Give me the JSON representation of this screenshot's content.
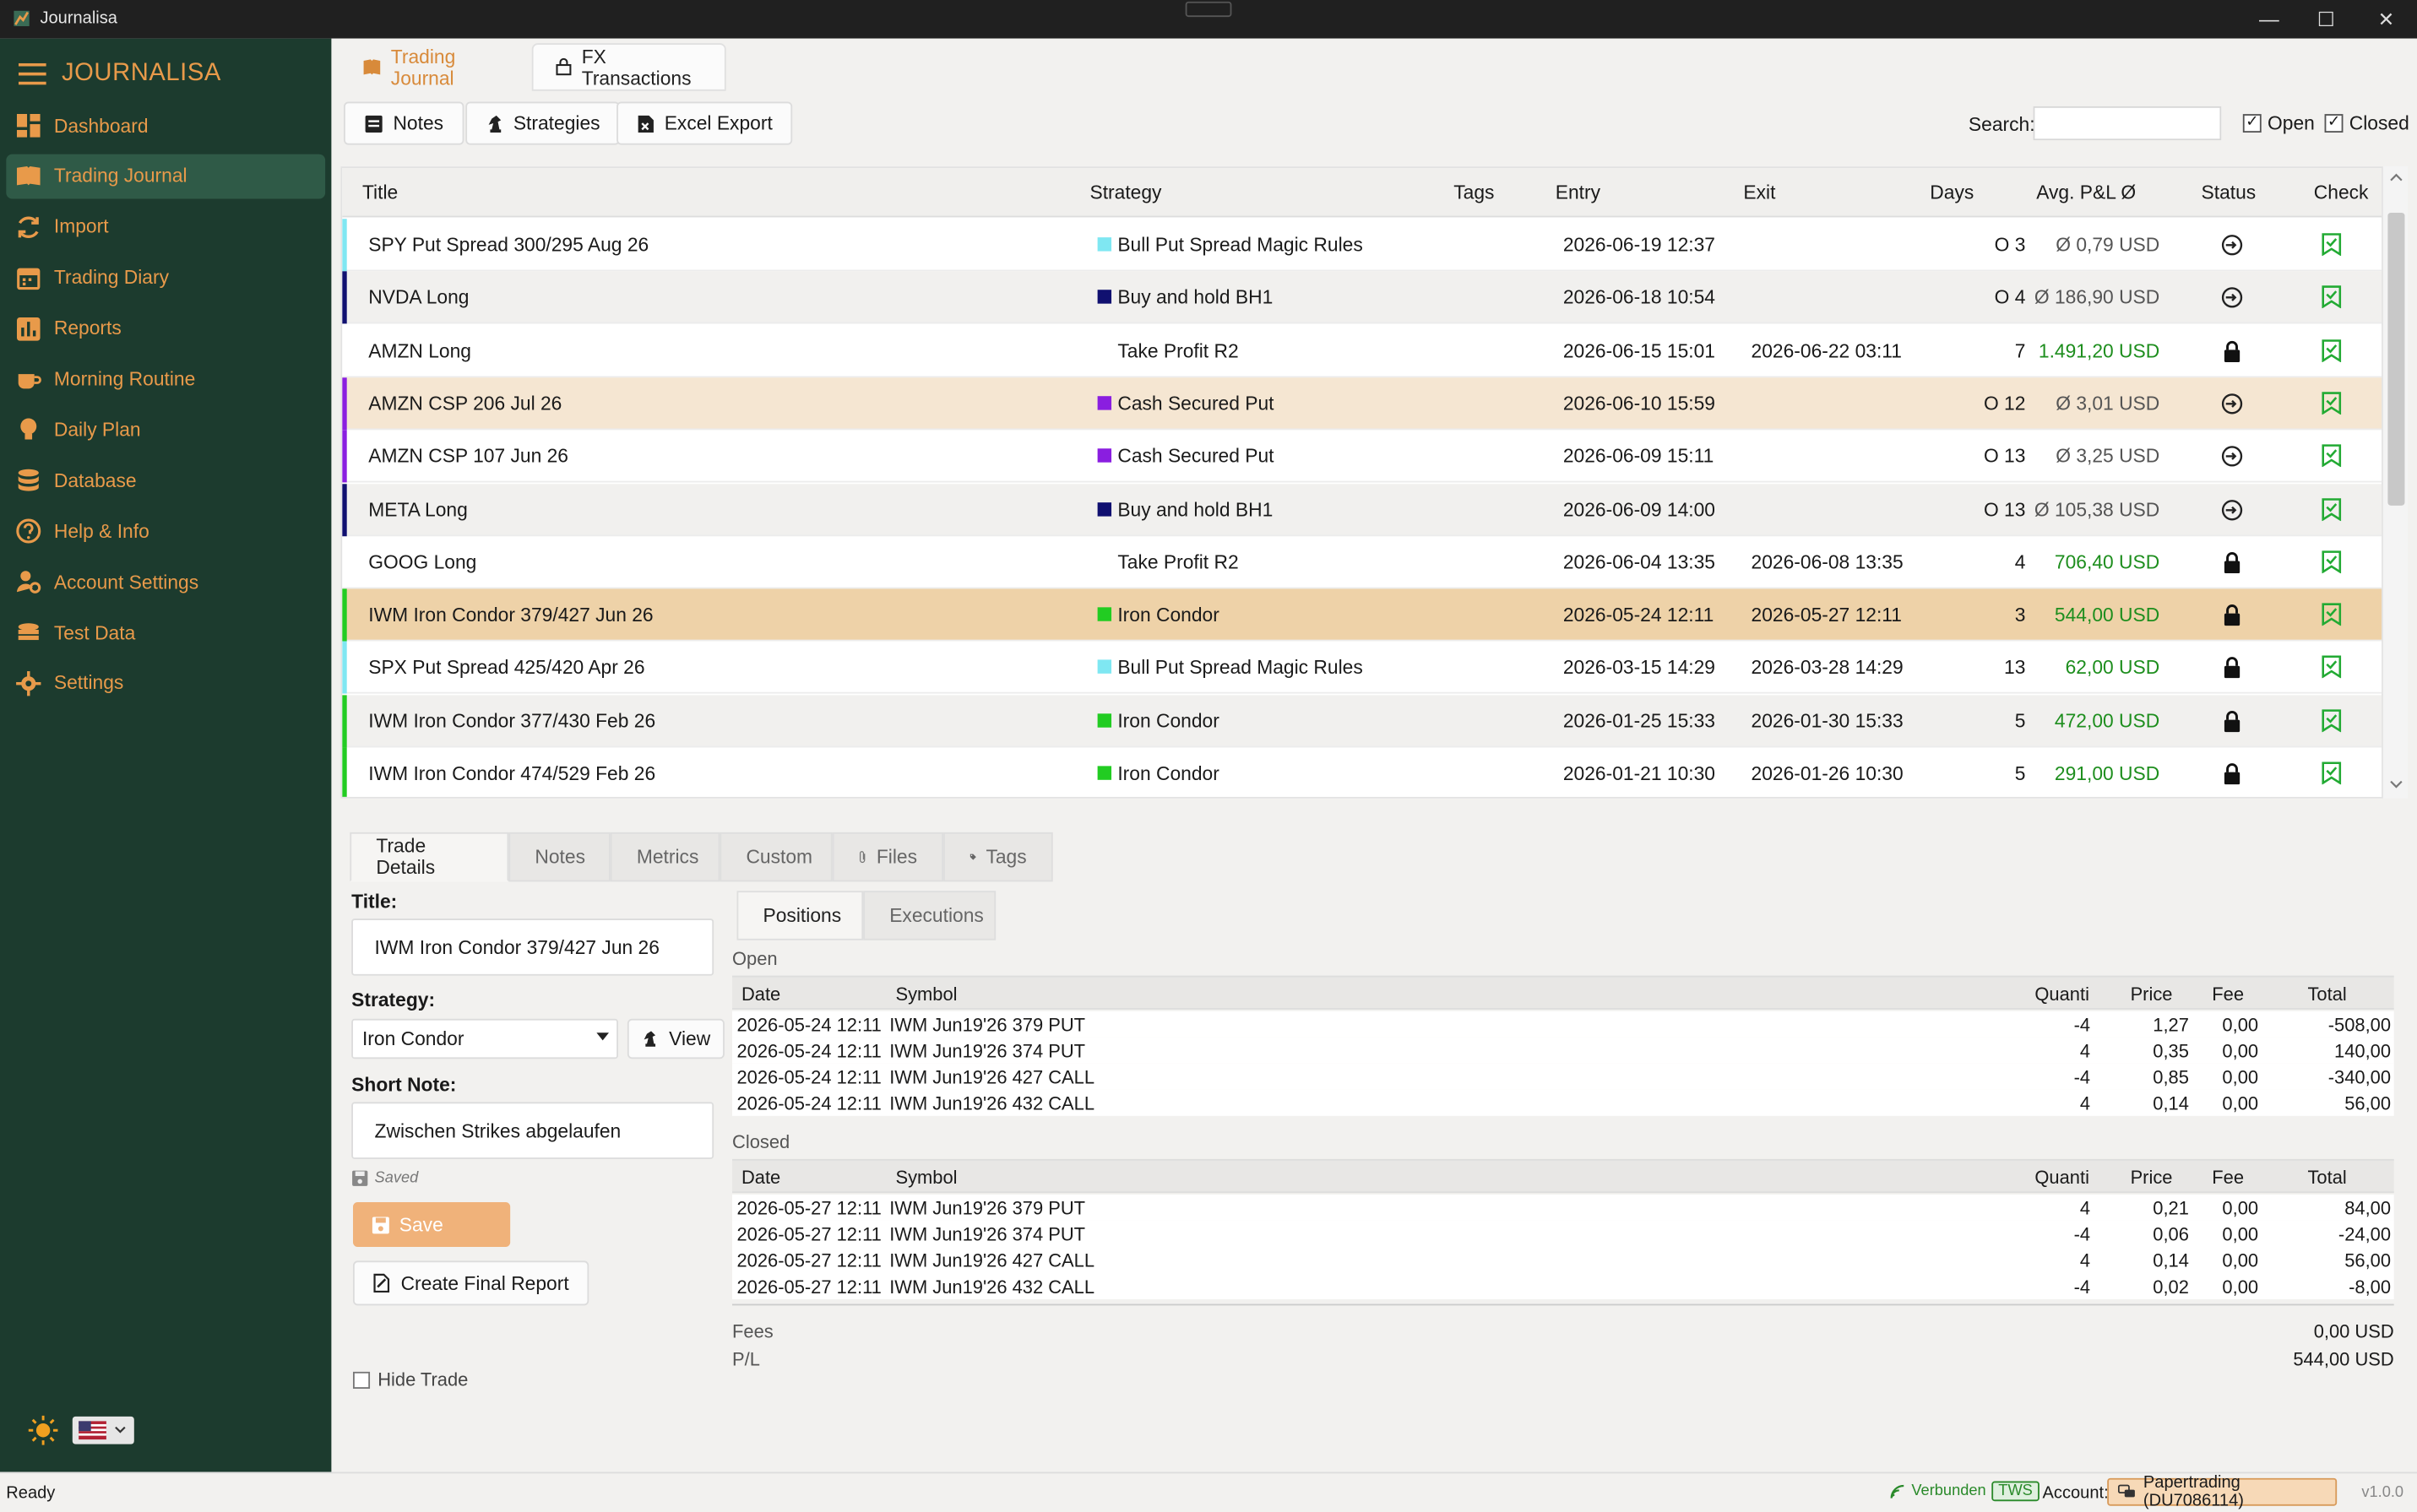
{
  "window": {
    "title": "Journalisa",
    "minimize": "—",
    "maximize": "☐",
    "close": "✕"
  },
  "sidebar": {
    "logo": "JOURNALISA",
    "items": [
      {
        "label": "Dashboard",
        "icon": "dashboard-icon"
      },
      {
        "label": "Trading Journal",
        "icon": "book-icon"
      },
      {
        "label": "Import",
        "icon": "sync-icon"
      },
      {
        "label": "Trading Diary",
        "icon": "calendar-icon"
      },
      {
        "label": "Reports",
        "icon": "bar-chart-icon"
      },
      {
        "label": "Morning Routine",
        "icon": "coffee-icon"
      },
      {
        "label": "Daily Plan",
        "icon": "lightbulb-icon"
      },
      {
        "label": "Database",
        "icon": "database-icon"
      },
      {
        "label": "Help & Info",
        "icon": "help-icon"
      },
      {
        "label": "Account Settings",
        "icon": "user-gear-icon"
      },
      {
        "label": "Test Data",
        "icon": "coins-icon"
      },
      {
        "label": "Settings",
        "icon": "gear-icon"
      }
    ],
    "active_index": 1
  },
  "top_tabs": [
    "Trading Journal",
    "FX Transactions"
  ],
  "toolbar": {
    "notes": "Notes",
    "strategies": "Strategies",
    "excel": "Excel Export",
    "search_label": "Search:",
    "search_value": "",
    "open_label": "Open",
    "closed_label": "Closed"
  },
  "grid": {
    "columns": [
      "Title",
      "Strategy",
      "Tags",
      "Entry",
      "Exit",
      "Days",
      "Avg. P&L Ø",
      "Status",
      "Check"
    ],
    "rows": [
      {
        "title": "SPY Put Spread 300/295 Aug 26",
        "strategy": "Bull Put Spread Magic Rules",
        "color": "#7fe7f2",
        "entry": "2026-06-19 12:37",
        "exit": "",
        "days": "O 3",
        "pl": "Ø 0,79 USD",
        "status": "open",
        "bg": "#ffffff",
        "plc": "pl-grey"
      },
      {
        "title": "NVDA Long",
        "strategy": "Buy and hold BH1",
        "color": "#101070",
        "entry": "2026-06-18 10:54",
        "exit": "",
        "days": "O 4",
        "pl": "Ø 186,90 USD",
        "status": "open",
        "bg": "#f1f0ee",
        "plc": "pl-grey"
      },
      {
        "title": "AMZN Long",
        "strategy": "Take Profit R2",
        "color": "",
        "entry": "2026-06-15 15:01",
        "exit": "2026-06-22 03:11",
        "days": "7",
        "pl": "1.491,20 USD",
        "status": "closed",
        "bg": "#ffffff",
        "plc": "pl-green"
      },
      {
        "title": "AMZN CSP 206 Jul 26",
        "strategy": "Cash Secured Put",
        "color": "#8a1ee0",
        "entry": "2026-06-10 15:59",
        "exit": "",
        "days": "O 12",
        "pl": "Ø 3,01 USD",
        "status": "open",
        "bg": "#f5e6d2",
        "plc": "pl-grey"
      },
      {
        "title": "AMZN CSP 107 Jun 26",
        "strategy": "Cash Secured Put",
        "color": "#8a1ee0",
        "entry": "2026-06-09 15:11",
        "exit": "",
        "days": "O 13",
        "pl": "Ø 3,25 USD",
        "status": "open",
        "bg": "#ffffff",
        "plc": "pl-grey"
      },
      {
        "title": "META Long",
        "strategy": "Buy and hold BH1",
        "color": "#101070",
        "entry": "2026-06-09 14:00",
        "exit": "",
        "days": "O 13",
        "pl": "Ø 105,38 USD",
        "status": "open",
        "bg": "#f1f0ee",
        "plc": "pl-grey"
      },
      {
        "title": "GOOG Long",
        "strategy": "Take Profit R2",
        "color": "",
        "entry": "2026-06-04 13:35",
        "exit": "2026-06-08 13:35",
        "days": "4",
        "pl": "706,40 USD",
        "status": "closed",
        "bg": "#ffffff",
        "plc": "pl-green"
      },
      {
        "title": "IWM Iron Condor 379/427 Jun 26",
        "strategy": "Iron Condor",
        "color": "#22cc22",
        "entry": "2026-05-24 12:11",
        "exit": "2026-05-27 12:11",
        "days": "3",
        "pl": "544,00 USD",
        "status": "closed",
        "bg": "#eed2a8",
        "plc": "pl-green"
      },
      {
        "title": "SPX Put Spread 425/420 Apr 26",
        "strategy": "Bull Put Spread Magic Rules",
        "color": "#7fe7f2",
        "entry": "2026-03-15 14:29",
        "exit": "2026-03-28 14:29",
        "days": "13",
        "pl": "62,00 USD",
        "status": "closed",
        "bg": "#ffffff",
        "plc": "pl-green"
      },
      {
        "title": "IWM Iron Condor 377/430 Feb 26",
        "strategy": "Iron Condor",
        "color": "#22cc22",
        "entry": "2026-01-25 15:33",
        "exit": "2026-01-30 15:33",
        "days": "5",
        "pl": "472,00 USD",
        "status": "closed",
        "bg": "#f1f0ee",
        "plc": "pl-green"
      },
      {
        "title": "IWM Iron Condor 474/529 Feb 26",
        "strategy": "Iron Condor",
        "color": "#22cc22",
        "entry": "2026-01-21 10:30",
        "exit": "2026-01-26 10:30",
        "days": "5",
        "pl": "291,00 USD",
        "status": "closed",
        "bg": "#ffffff",
        "plc": "pl-green"
      }
    ]
  },
  "detail_tabs": [
    "Trade Details",
    "Notes",
    "Metrics",
    "Custom",
    "Files",
    "Tags"
  ],
  "details": {
    "title_label": "Title:",
    "title_value": "IWM Iron Condor 379/427 Jun 26",
    "strategy_label": "Strategy:",
    "strategy_value": "Iron Condor",
    "view": "View",
    "note_label": "Short Note:",
    "note_value": "Zwischen Strikes abgelaufen",
    "saved": "Saved",
    "save": "Save",
    "final_report": "Create Final Report",
    "hide_trade": "Hide Trade"
  },
  "position_tabs": [
    "Positions",
    "Executions"
  ],
  "positions": {
    "open_label": "Open",
    "closed_label": "Closed",
    "columns": [
      "Date",
      "Symbol",
      "Quanti",
      "Price",
      "Fee",
      "Total"
    ],
    "open": [
      [
        "2026-05-24 12:11",
        "IWM Jun19'26 379 PUT",
        "-4",
        "1,27",
        "0,00",
        "-508,00"
      ],
      [
        "2026-05-24 12:11",
        "IWM Jun19'26 374 PUT",
        "4",
        "0,35",
        "0,00",
        "140,00"
      ],
      [
        "2026-05-24 12:11",
        "IWM Jun19'26 427 CALL",
        "-4",
        "0,85",
        "0,00",
        "-340,00"
      ],
      [
        "2026-05-24 12:11",
        "IWM Jun19'26 432 CALL",
        "4",
        "0,14",
        "0,00",
        "56,00"
      ]
    ],
    "closed": [
      [
        "2026-05-27 12:11",
        "IWM Jun19'26 379 PUT",
        "4",
        "0,21",
        "0,00",
        "84,00"
      ],
      [
        "2026-05-27 12:11",
        "IWM Jun19'26 374 PUT",
        "-4",
        "0,06",
        "0,00",
        "-24,00"
      ],
      [
        "2026-05-27 12:11",
        "IWM Jun19'26 427 CALL",
        "4",
        "0,14",
        "0,00",
        "56,00"
      ],
      [
        "2026-05-27 12:11",
        "IWM Jun19'26 432 CALL",
        "-4",
        "0,02",
        "0,00",
        "-8,00"
      ]
    ],
    "fees_label": "Fees",
    "fees_value": "0,00 USD",
    "pl_label": "P/L",
    "pl_value": "544,00 USD"
  },
  "statusbar": {
    "left": "Ready",
    "connected": "Verbunden",
    "tws": "TWS",
    "account_label": "Account:",
    "account": "Papertrading (DU7086114)",
    "version": "v1.0.0"
  },
  "colors": {
    "sidebar": "#1c3b2e",
    "accent": "#e89a4a",
    "green": "#1e8e1e"
  }
}
